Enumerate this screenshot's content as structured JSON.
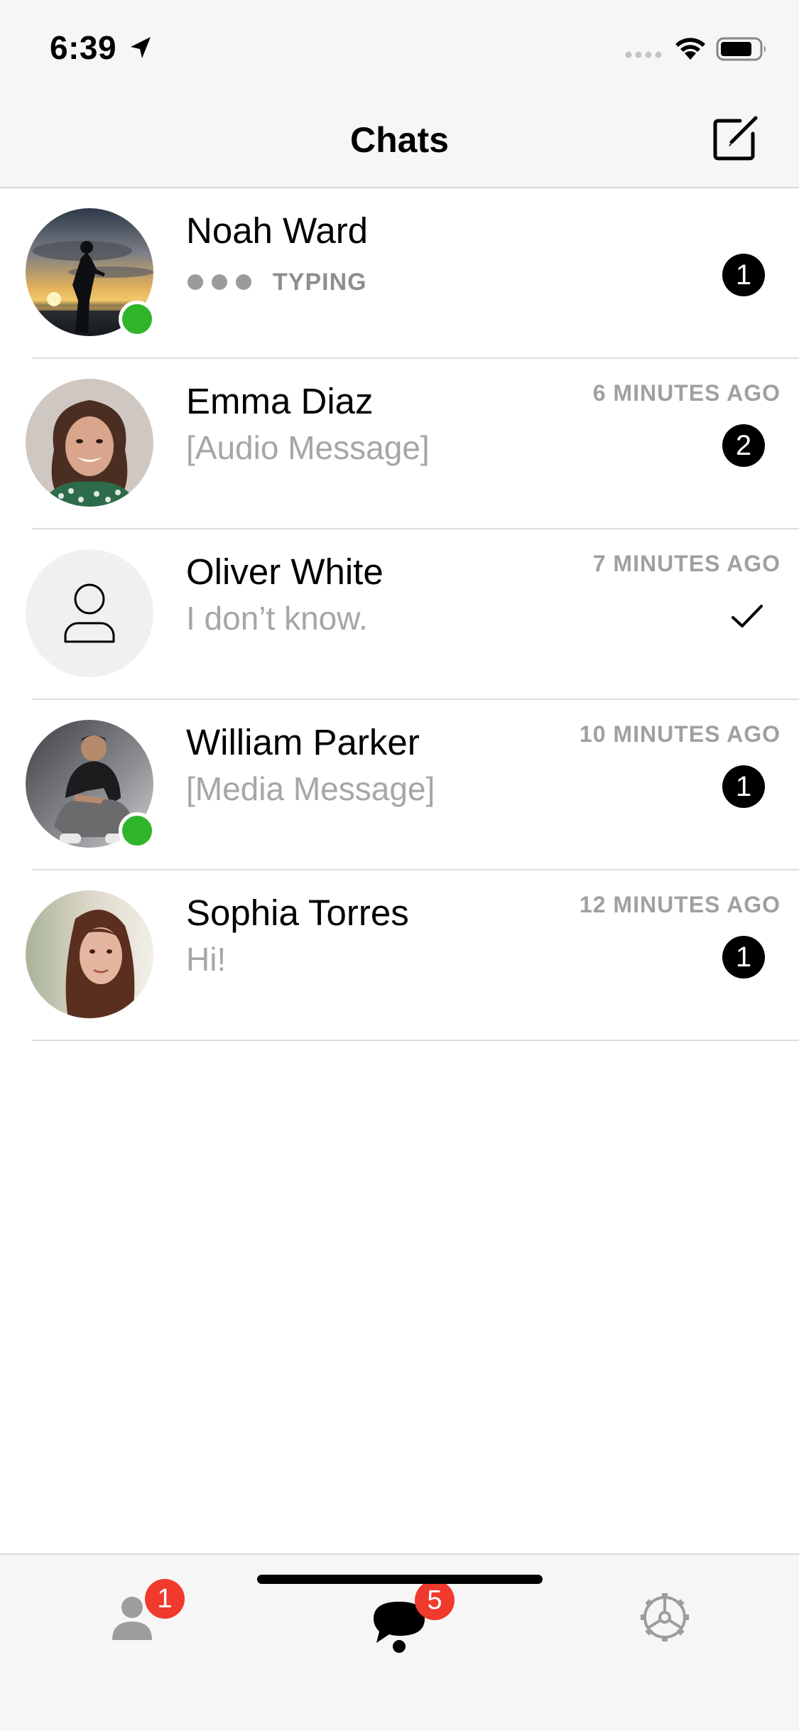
{
  "status_bar": {
    "time": "6:39",
    "location_icon": "location-arrow-icon",
    "signal_icon": "signal-icon",
    "wifi_icon": "wifi-icon",
    "battery_icon": "battery-icon"
  },
  "nav": {
    "title": "Chats",
    "compose_icon": "compose-icon"
  },
  "chats": [
    {
      "name": "Noah Ward",
      "status": "typing",
      "typing_label": "TYPING",
      "time": "",
      "unread": "1",
      "online": true,
      "avatar": "sunset-silhouette-photo"
    },
    {
      "name": "Emma Diaz",
      "preview": "[Audio Message]",
      "time": "6 MINUTES AGO",
      "unread": "2",
      "online": false,
      "avatar": "woman-curly-hair-photo"
    },
    {
      "name": "Oliver White",
      "preview": "I don’t know.",
      "time": "7 MINUTES AGO",
      "read": true,
      "online": false,
      "avatar": "default-person-icon"
    },
    {
      "name": "William Parker",
      "preview": "[Media Message]",
      "time": "10 MINUTES AGO",
      "unread": "1",
      "online": true,
      "avatar": "man-crouching-photo"
    },
    {
      "name": "Sophia Torres",
      "preview": "Hi!",
      "time": "12 MINUTES AGO",
      "unread": "1",
      "online": false,
      "avatar": "woman-portrait-photo"
    }
  ],
  "tab_bar": {
    "tabs": [
      {
        "name": "contacts",
        "icon": "person-icon",
        "badge": "1"
      },
      {
        "name": "chats",
        "icon": "chat-bubble-icon",
        "badge": "5",
        "active": true
      },
      {
        "name": "settings",
        "icon": "gear-icon"
      }
    ]
  },
  "colors": {
    "online": "#2fb52a",
    "badge_red": "#f03a2e",
    "unread_badge": "#000000",
    "secondary_text": "#a6a6a6"
  }
}
